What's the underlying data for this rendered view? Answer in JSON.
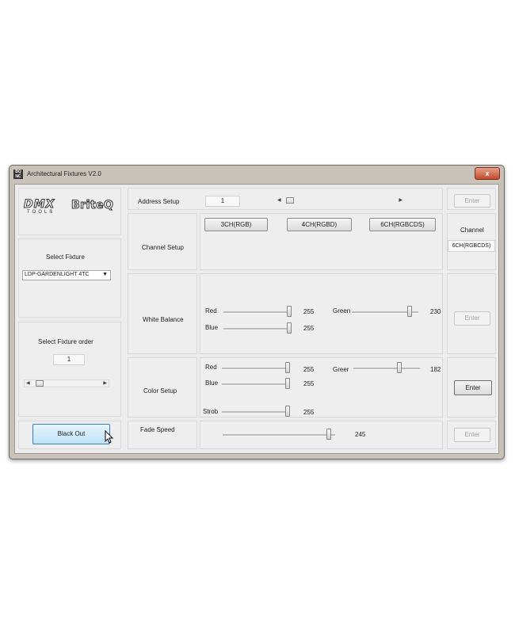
{
  "window": {
    "title": "Architectural Fixtures V2.0",
    "icon": "app-icon",
    "close": "x"
  },
  "logo": {
    "left": "DMX",
    "left_sub": "TOOLS",
    "right": "BriteQ"
  },
  "fixture": {
    "label": "Select Fixture",
    "value": "LDP-GARDENLIGHT 4TC"
  },
  "fixture_order": {
    "label": "Select Fixture order",
    "value": "1",
    "scroll_level": 0.05
  },
  "blackout": {
    "label": "Black Out"
  },
  "address": {
    "label": "Address Setup",
    "value": "1",
    "scroll_level": 0.02,
    "enter": "Enter"
  },
  "channel_setup": {
    "label": "Channel Setup",
    "buttons": [
      "3CH(RGB)",
      "4CH(RGBD)",
      "6CH(RGBCDS)"
    ],
    "channel_label": "Channel",
    "channel_value": "6CH(RGBCDS)"
  },
  "white_balance": {
    "label": "White Balance",
    "red": {
      "label": "Red",
      "value": "255",
      "level": 1.0
    },
    "blue": {
      "label": "Blue",
      "value": "255",
      "level": 1.0
    },
    "green": {
      "label": "Green",
      "value": "230",
      "level": 0.9
    },
    "enter": "Enter"
  },
  "color_setup": {
    "label": "Color Setup",
    "red": {
      "label": "Red",
      "value": "255",
      "level": 1.0
    },
    "blue": {
      "label": "Blue",
      "value": "255",
      "level": 1.0
    },
    "green": {
      "label": "Greer",
      "value": "182",
      "level": 0.71
    },
    "strob": {
      "label": "Strob",
      "value": "255",
      "level": 1.0
    },
    "enter": "Enter"
  },
  "fade": {
    "label": "Fade  Speed",
    "value": "245",
    "level": 0.96,
    "enter": "Enter"
  }
}
